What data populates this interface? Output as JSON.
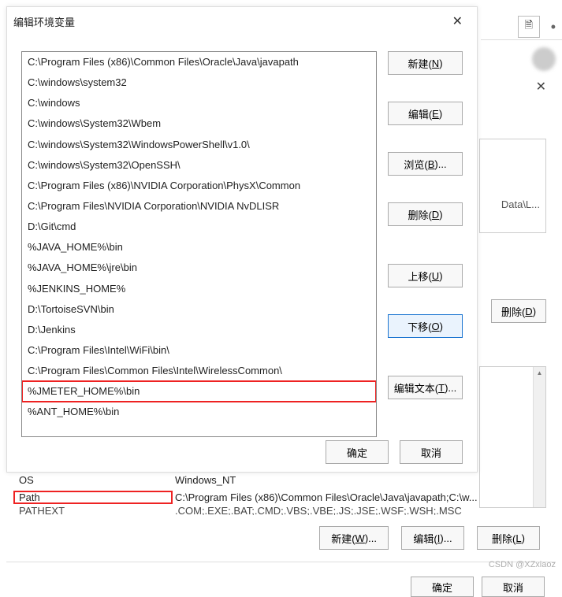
{
  "dialog": {
    "title": "编辑环境变量",
    "close_glyph": "✕",
    "buttons": {
      "new_label": "新建(N)",
      "edit_label": "编辑(E)",
      "browse_label": "浏览(B)...",
      "delete_label": "删除(D)",
      "moveup_label": "上移(U)",
      "movedown_label": "下移(O)",
      "edittext_label": "编辑文本(T)...",
      "ok_label": "确定",
      "cancel_label": "取消"
    },
    "path_entries": [
      "C:\\Program Files (x86)\\Common Files\\Oracle\\Java\\javapath",
      "C:\\windows\\system32",
      "C:\\windows",
      "C:\\windows\\System32\\Wbem",
      "C:\\windows\\System32\\WindowsPowerShell\\v1.0\\",
      "C:\\windows\\System32\\OpenSSH\\",
      "C:\\Program Files (x86)\\NVIDIA Corporation\\PhysX\\Common",
      "C:\\Program Files\\NVIDIA Corporation\\NVIDIA NvDLISR",
      "D:\\Git\\cmd",
      "%JAVA_HOME%\\bin",
      "%JAVA_HOME%\\jre\\bin",
      "%JENKINS_HOME%",
      "D:\\TortoiseSVN\\bin",
      "D:\\Jenkins",
      "C:\\Program Files\\Intel\\WiFi\\bin\\",
      "C:\\Program Files\\Common Files\\Intel\\WirelessCommon\\",
      "%JMETER_HOME%\\bin",
      "%ANT_HOME%\\bin"
    ],
    "selected_index": 16,
    "highlighted_index": 16
  },
  "background": {
    "close_glyph": "✕",
    "doc_icon_glyph": "🗎",
    "dot": "•",
    "snippet_text": "Data\\L...",
    "delete_d_label": "删除(D)",
    "scroll_up_glyph": "▲",
    "new_w_label": "新建(W)...",
    "edit_i_label": "编辑(I)...",
    "delete_l_label": "删除(L)",
    "ok_label": "确定",
    "cancel_label": "取消"
  },
  "table": {
    "rows": [
      {
        "var": "OS",
        "val": "Windows_NT"
      },
      {
        "var": "Path",
        "val": "C:\\Program Files (x86)\\Common Files\\Oracle\\Java\\javapath;C:\\w...",
        "highlighted": true
      },
      {
        "var": "PATHEXT",
        "val": ".COM;.EXE;.BAT;.CMD;.VBS;.VBE;.JS;.JSE;.WSF;.WSH;.MSC"
      }
    ]
  },
  "watermark": "CSDN @XZxiaoz"
}
